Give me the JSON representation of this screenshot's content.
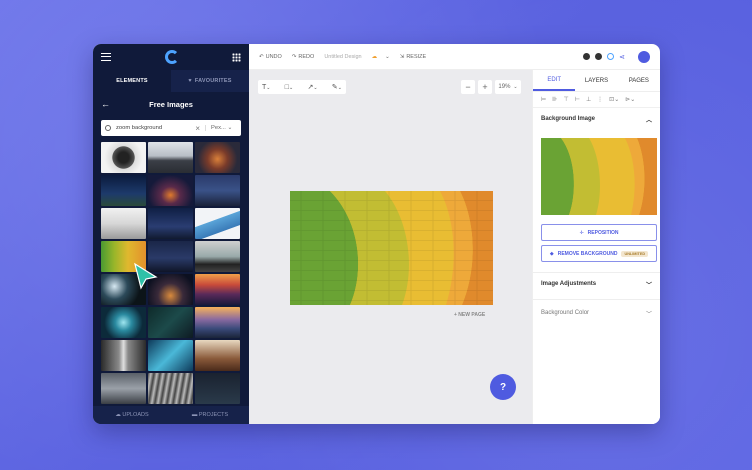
{
  "left_panel": {
    "tabs": [
      {
        "label": "ELEMENTS",
        "active": true
      },
      {
        "label": "FAVOURITES",
        "icon": "heart-icon",
        "active": false
      }
    ],
    "header_title": "Free Images",
    "search": {
      "value": "zoom background",
      "source": "Pex..."
    },
    "bottom_tabs": [
      {
        "label": "UPLOADS",
        "icon": "cloud-upload-icon"
      },
      {
        "label": "PROJECTS",
        "icon": "folder-icon"
      }
    ]
  },
  "topbar": {
    "undo": "UNDO",
    "redo": "REDO",
    "doc_title": "Untitled Design",
    "resize": "RESIZE"
  },
  "canvas": {
    "zoom_value": "19%",
    "new_page": "+ NEW PAGE",
    "help": "?"
  },
  "right_panel": {
    "tabs": [
      {
        "label": "EDIT",
        "active": true
      },
      {
        "label": "LAYERS",
        "active": false
      },
      {
        "label": "PAGES",
        "active": false
      }
    ],
    "background_image_title": "Background Image",
    "reposition_label": "REPOSITION",
    "remove_bg_label": "REMOVE BACKGROUND",
    "remove_bg_badge": "UNLIMITED",
    "image_adjustments_title": "Image Adjustments",
    "background_color_title": "Background Color"
  },
  "colors": {
    "accent": "#4f5be0",
    "sidebar": "#101a3a"
  }
}
